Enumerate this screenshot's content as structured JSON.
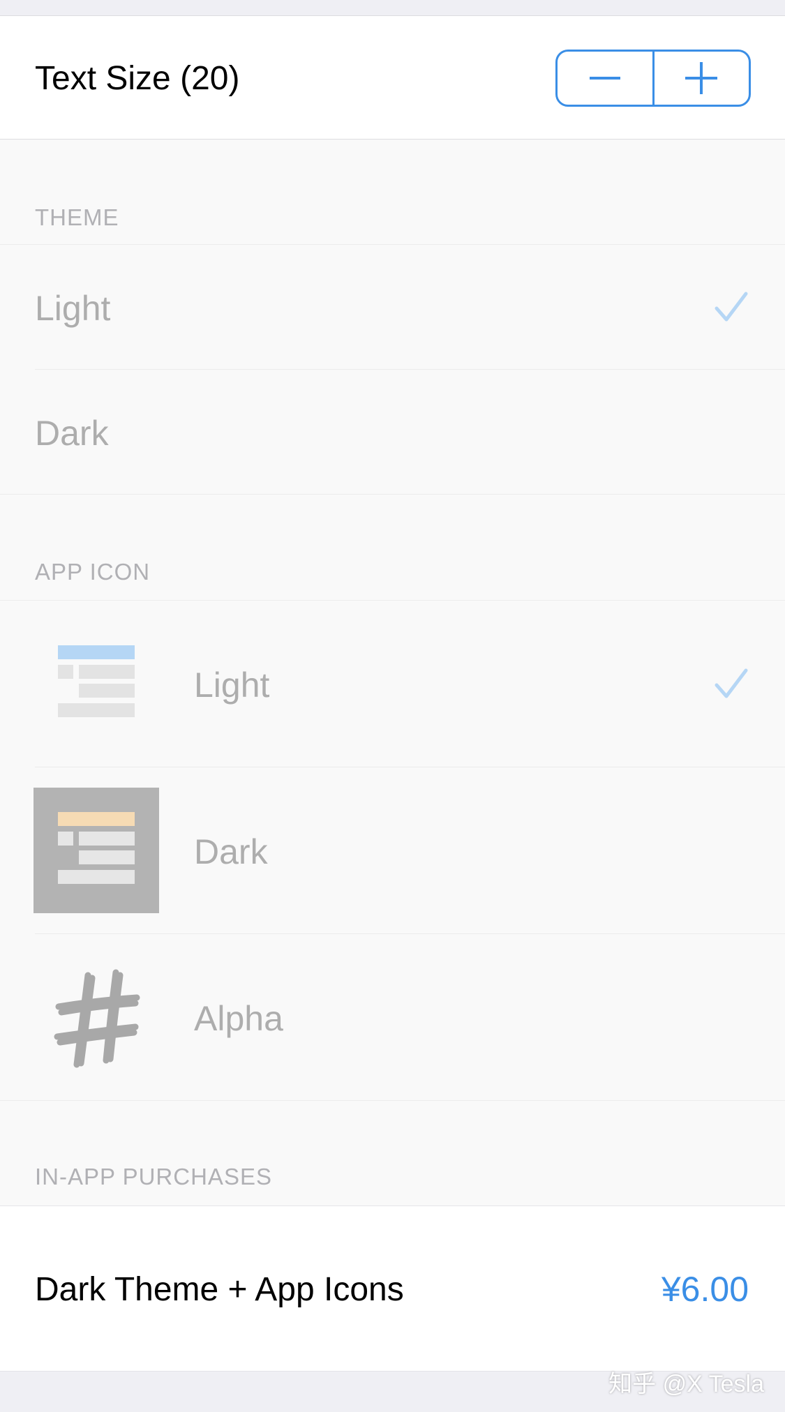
{
  "text_size": {
    "label": "Text Size (20)",
    "decrease": "minus-icon",
    "increase": "plus-icon"
  },
  "theme": {
    "header": "THEME",
    "items": [
      {
        "label": "Light",
        "selected": true
      },
      {
        "label": "Dark",
        "selected": false
      }
    ]
  },
  "app_icon": {
    "header": "APP ICON",
    "items": [
      {
        "label": "Light",
        "icon": "light-app-icon",
        "selected": true
      },
      {
        "label": "Dark",
        "icon": "dark-app-icon",
        "selected": false
      },
      {
        "label": "Alpha",
        "icon": "hash-app-icon",
        "selected": false
      }
    ]
  },
  "in_app_purchases": {
    "header": "IN-APP PURCHASES",
    "item": {
      "label": "Dark Theme + App Icons",
      "price": "¥6.00"
    }
  },
  "watermark": "知乎 @X Tesla",
  "colors": {
    "accent": "#3a8ee6",
    "dim_text": "#adadad",
    "check": "#b5d6f5",
    "background": "#efeff4"
  }
}
